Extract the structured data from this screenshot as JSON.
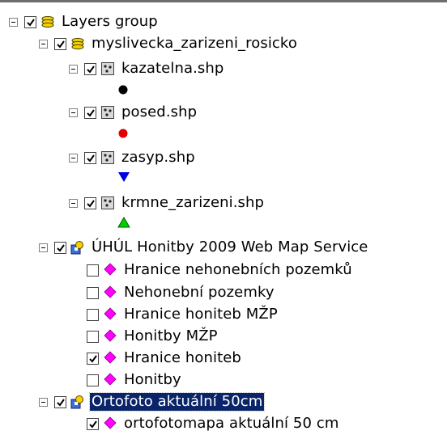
{
  "tree": {
    "root": {
      "label": "Layers group",
      "checked": true,
      "icon": "layers-group-icon"
    },
    "group": {
      "label": "myslivecka_zarizeni_rosicko",
      "checked": true,
      "icon": "layers-group-icon"
    },
    "shp_layers": [
      {
        "label": "kazatelna.shp",
        "checked": true,
        "icon": "point-layer-icon",
        "symbol": "circle",
        "symbol_color": "#000000"
      },
      {
        "label": "posed.shp",
        "checked": true,
        "icon": "point-layer-icon",
        "symbol": "circle",
        "symbol_color": "#e00000"
      },
      {
        "label": "zasyp.shp",
        "checked": true,
        "icon": "point-layer-icon",
        "symbol": "triangle-down",
        "symbol_color": "#0000e0"
      },
      {
        "label": "krmne_zarizeni.shp",
        "checked": true,
        "icon": "point-layer-icon",
        "symbol": "triangle-up",
        "symbol_color": "#00d000"
      }
    ],
    "wms1": {
      "label": "ÚHÚL Honitby 2009 Web Map Service",
      "checked": true,
      "icon": "wms-service-icon",
      "sublayers": [
        {
          "label": "Hranice nehonebních pozemků",
          "checked": false
        },
        {
          "label": "Nehonební pozemky",
          "checked": false
        },
        {
          "label": "Hranice honiteb MŽP",
          "checked": false
        },
        {
          "label": "Honitby MŽP",
          "checked": false
        },
        {
          "label": "Hranice honiteb",
          "checked": true
        },
        {
          "label": "Honitby",
          "checked": false
        }
      ]
    },
    "wms2": {
      "label": "Ortofoto aktuální 50cm",
      "checked": true,
      "selected": true,
      "icon": "wms-service-icon",
      "sublayers": [
        {
          "label": "ortofotomapa aktuální 50 cm",
          "checked": true
        }
      ]
    }
  },
  "colors": {
    "selection_bg": "#0a246a",
    "sublayer_diamond": "#ff00ff",
    "layer_group_yellow": "#f5d000"
  }
}
